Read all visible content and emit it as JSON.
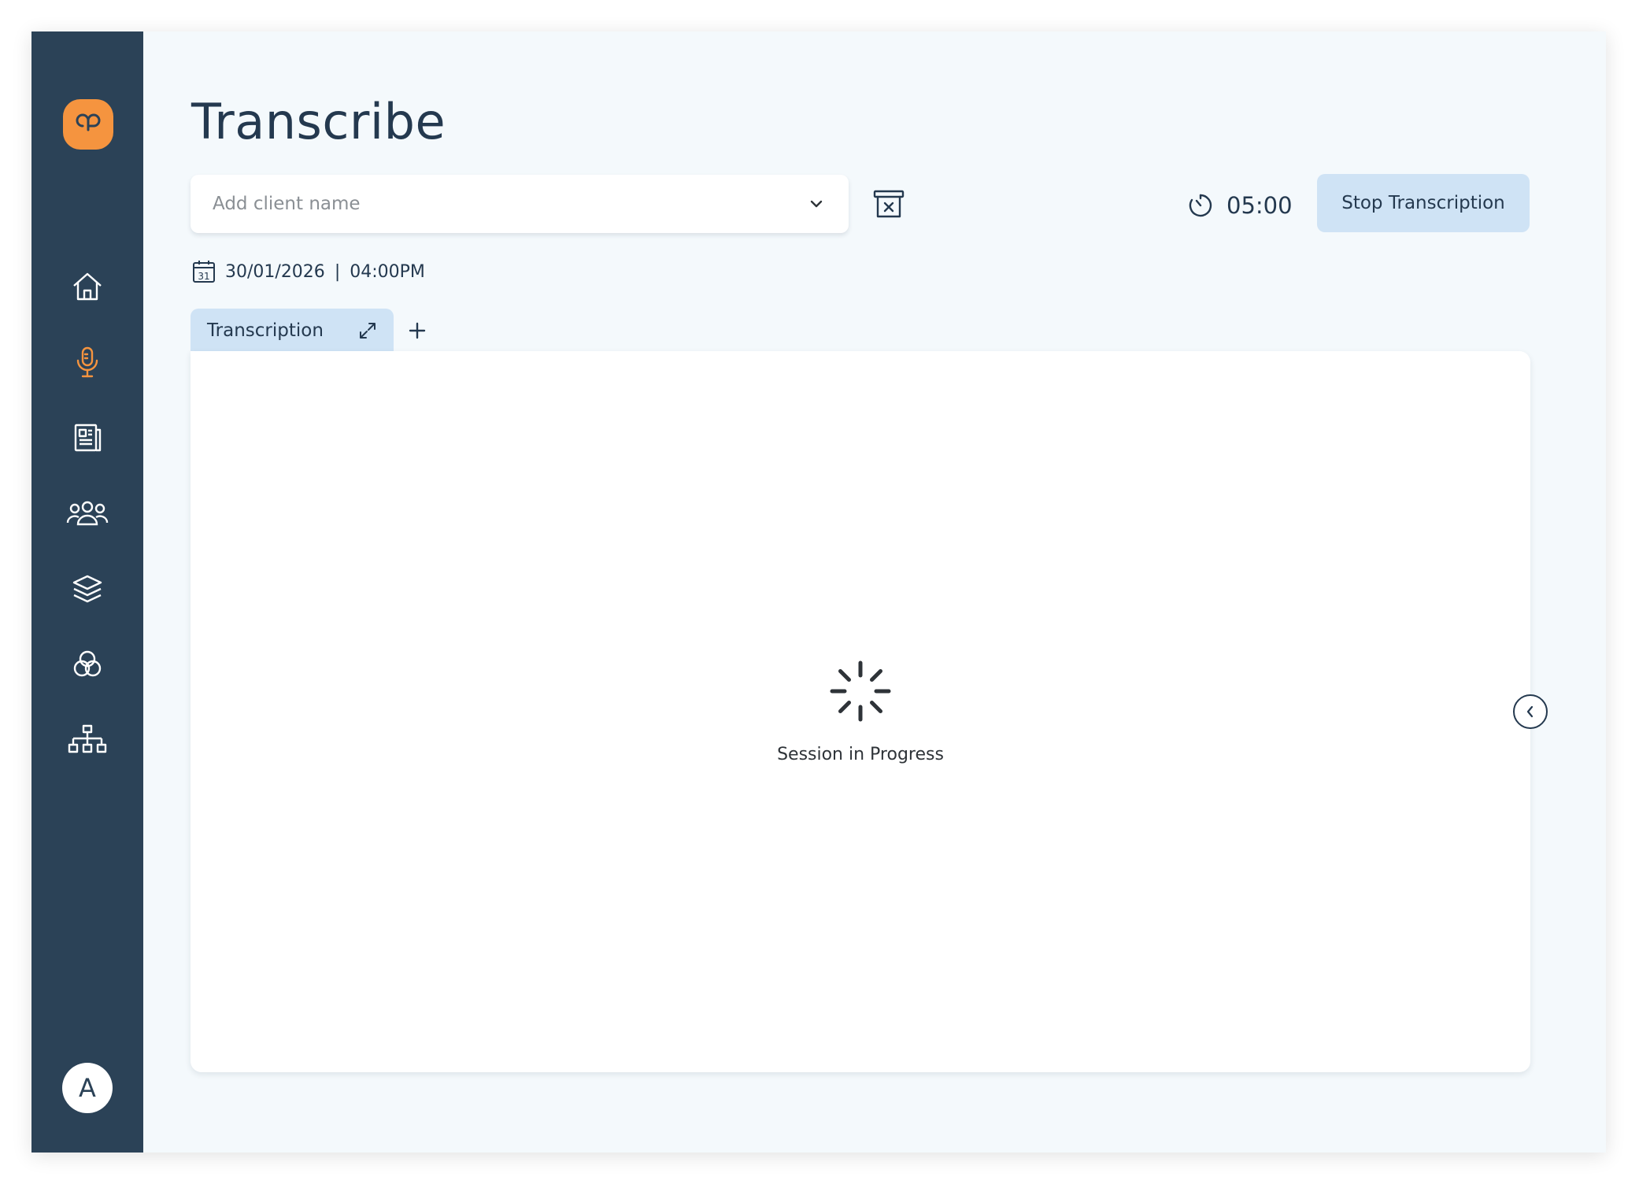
{
  "colors": {
    "sidebar_bg": "#2b4257",
    "accent": "#f5943f",
    "primary_text": "#24394f",
    "button_bg": "#cfe3f5",
    "page_bg": "#f4f9fc"
  },
  "sidebar": {
    "logo_icon": "brand-logo-icon",
    "items": [
      {
        "icon": "home-icon",
        "active": false
      },
      {
        "icon": "microphone-icon",
        "active": true
      },
      {
        "icon": "document-icon",
        "active": false
      },
      {
        "icon": "people-icon",
        "active": false
      },
      {
        "icon": "layers-icon",
        "active": false
      },
      {
        "icon": "circles-icon",
        "active": false
      },
      {
        "icon": "hierarchy-icon",
        "active": false
      }
    ],
    "avatar_initial": "A"
  },
  "header": {
    "title": "Transcribe",
    "client_field": {
      "placeholder": "Add client name",
      "value": ""
    },
    "timer": "05:00",
    "stop_button_label": "Stop Transcription"
  },
  "session": {
    "date": "30/01/2026",
    "separator": "|",
    "time": "04:00PM",
    "calendar_day": "31"
  },
  "tabs": [
    {
      "label": "Transcription",
      "active": true
    }
  ],
  "panel": {
    "status_text": "Session in Progress"
  }
}
